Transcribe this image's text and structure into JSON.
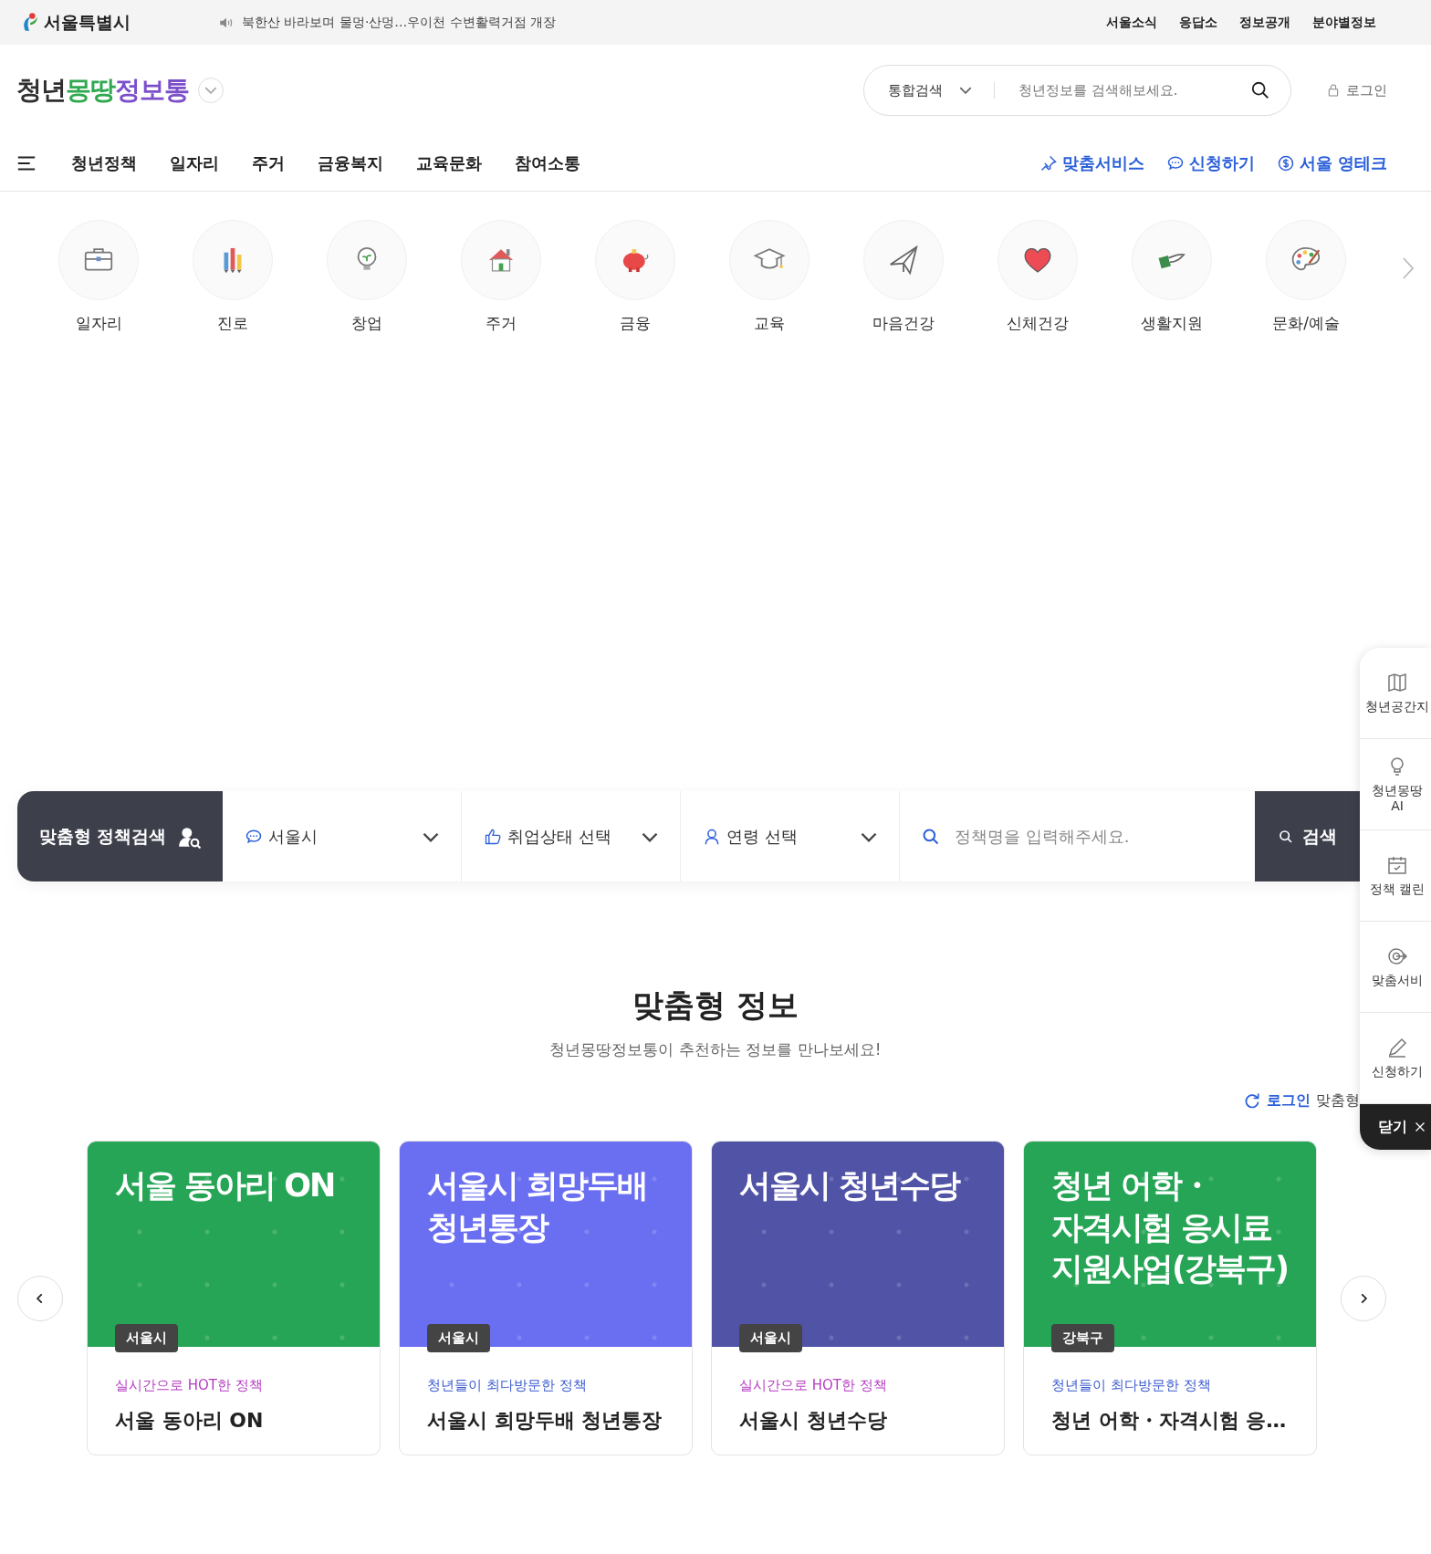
{
  "top_bar": {
    "city_logo": "서울특별시",
    "notice": "북한산 바라보며 물멍·산멍…우이천 수변활력거점 개장",
    "links": [
      "서울소식",
      "응답소",
      "정보공개",
      "분야별정보"
    ]
  },
  "header": {
    "logo": [
      {
        "text": "청년",
        "color": "#2f2f2f"
      },
      {
        "text": "몽땅",
        "color": "#2fa84f"
      },
      {
        "text": "정보통",
        "color": "#7b4fc9"
      }
    ],
    "search": {
      "scope": "통합검색",
      "placeholder": "청년정보를 검색해보세요."
    },
    "login": "로그인"
  },
  "nav": {
    "items": [
      "청년정책",
      "일자리",
      "주거",
      "금융복지",
      "교육문화",
      "참여소통"
    ],
    "quick_links": [
      "맞춤서비스",
      "신청하기",
      "서울 영테크"
    ]
  },
  "categories": [
    {
      "label": "일자리"
    },
    {
      "label": "진로"
    },
    {
      "label": "창업"
    },
    {
      "label": "주거"
    },
    {
      "label": "금융"
    },
    {
      "label": "교육"
    },
    {
      "label": "마음건강"
    },
    {
      "label": "신체건강"
    },
    {
      "label": "생활지원"
    },
    {
      "label": "문화/예술"
    }
  ],
  "policy_search": {
    "title": "맞춤형 정책검색",
    "region": "서울시",
    "employment": "취업상태 선택",
    "age": "연령 선택",
    "placeholder": "정책명을 입력해주세요.",
    "button": "검색"
  },
  "side_panel": {
    "items": [
      {
        "label": "청년공간지"
      },
      {
        "label": "청년몽땅\nAI"
      },
      {
        "label": "정책 캘린"
      },
      {
        "label": "맞춤서비"
      },
      {
        "label": "신청하기"
      }
    ],
    "close": "닫기"
  },
  "section": {
    "title": "맞춤형 정보",
    "subtitle": "청년몽땅정보통이 추천하는 정보를 만나보세요!",
    "login_link": "로그인",
    "login_note": "맞춤형",
    "cards": [
      {
        "banner_title": "서울 동아리 ON",
        "color": "#27a556",
        "tag": "서울시",
        "subtitle": {
          "text": "실시간으로 HOT한 정책",
          "color": "#b43cc0"
        },
        "title": "서울 동아리 ON"
      },
      {
        "banner_title": "서울시 희망두배 청년통장",
        "color": "#6a6ef0",
        "tag": "서울시",
        "subtitle": {
          "text": "청년들이 최다방문한 정책",
          "color": "#3a5bd0"
        },
        "title": "서울시 희망두배 청년통장"
      },
      {
        "banner_title": "서울시 청년수당",
        "color": "#5053a6",
        "tag": "서울시",
        "subtitle": {
          "text": "실시간으로 HOT한 정책",
          "color": "#b43cc0"
        },
        "title": "서울시 청년수당"
      },
      {
        "banner_title": "청년 어학・자격시험 응시료 지원사업(강북구)",
        "color": "#27a556",
        "tag": "강북구",
        "subtitle": {
          "text": "청년들이 최다방문한 정책",
          "color": "#3a5bd0"
        },
        "title": "청년 어학・자격시험 응…"
      }
    ]
  }
}
